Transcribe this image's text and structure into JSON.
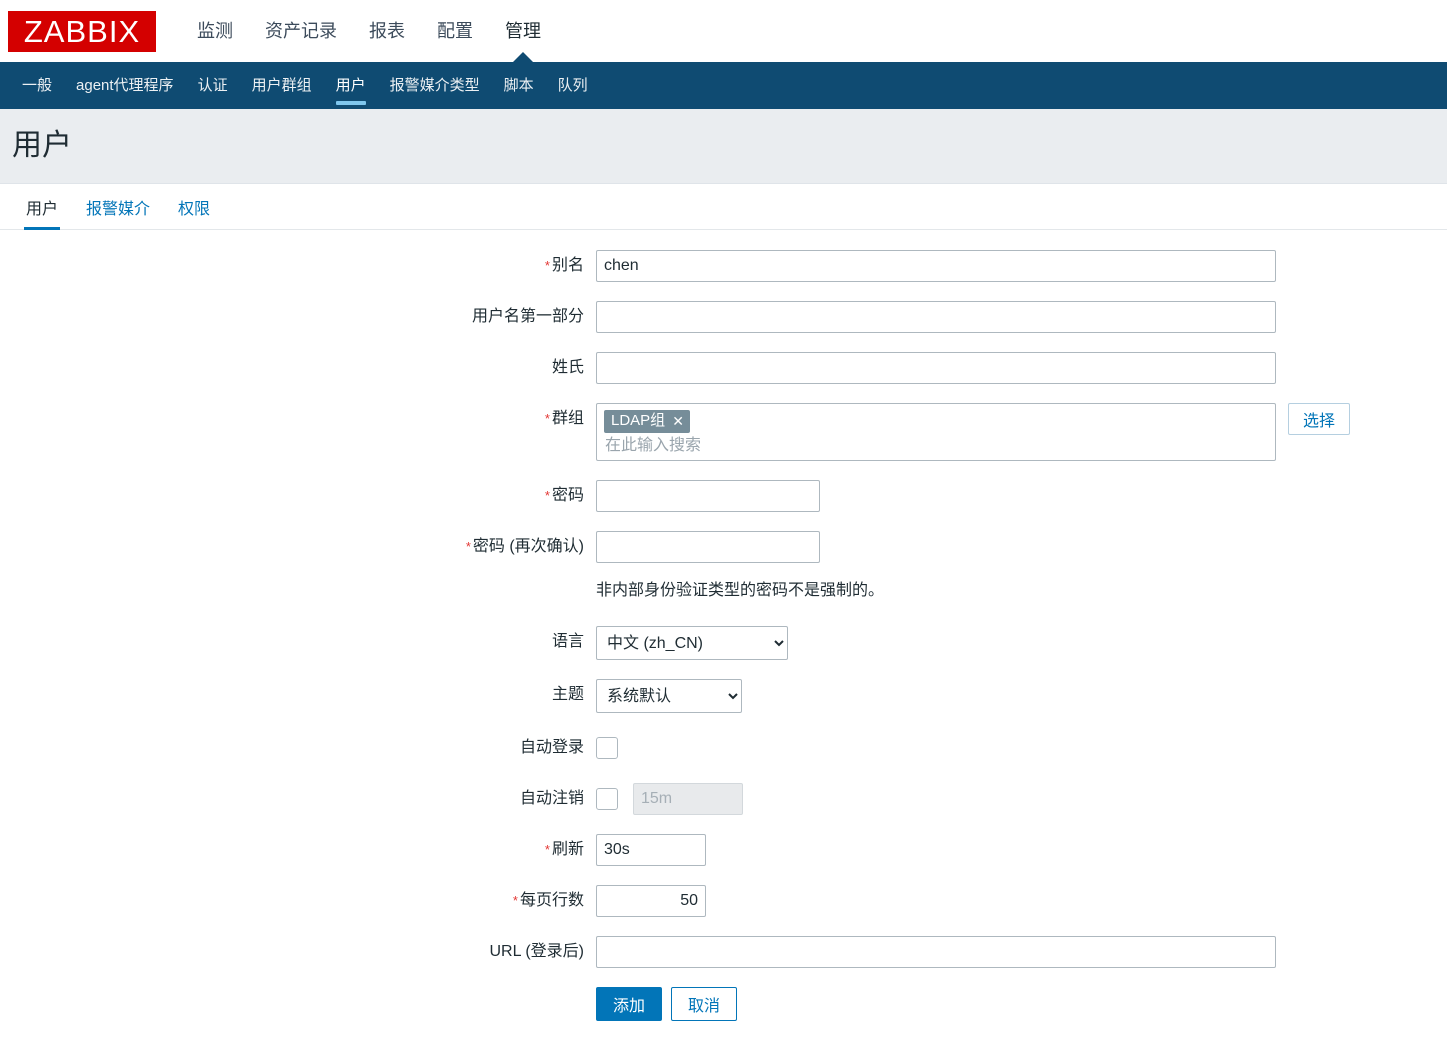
{
  "brand": {
    "logo_text": "ZABBIX",
    "logo_bg": "#d40000",
    "accent": "#0275b8",
    "subnav_bg": "#0f4b72"
  },
  "main_nav": [
    {
      "label": "监测",
      "active": false
    },
    {
      "label": "资产记录",
      "active": false
    },
    {
      "label": "报表",
      "active": false
    },
    {
      "label": "配置",
      "active": false
    },
    {
      "label": "管理",
      "active": true
    }
  ],
  "sub_nav": [
    {
      "label": "一般",
      "active": false
    },
    {
      "label": "agent代理程序",
      "active": false
    },
    {
      "label": "认证",
      "active": false
    },
    {
      "label": "用户群组",
      "active": false
    },
    {
      "label": "用户",
      "active": true
    },
    {
      "label": "报警媒介类型",
      "active": false
    },
    {
      "label": "脚本",
      "active": false
    },
    {
      "label": "队列",
      "active": false
    }
  ],
  "header": {
    "title": "用户"
  },
  "tabs": [
    {
      "label": "用户",
      "active": true
    },
    {
      "label": "报警媒介",
      "active": false
    },
    {
      "label": "权限",
      "active": false
    }
  ],
  "form": {
    "alias": {
      "label": "别名",
      "required": true,
      "value": "chen"
    },
    "name": {
      "label": "用户名第一部分",
      "required": false,
      "value": ""
    },
    "surname": {
      "label": "姓氏",
      "required": false,
      "value": ""
    },
    "groups": {
      "label": "群组",
      "required": true,
      "pills": [
        {
          "text": "LDAP组",
          "remove_icon": "✕"
        }
      ],
      "placeholder": "在此输入搜索",
      "select_button": "选择"
    },
    "password": {
      "label": "密码",
      "required": true,
      "value": ""
    },
    "password2": {
      "label": "密码 (再次确认)",
      "required": true,
      "value": ""
    },
    "password_hint": "非内部身份验证类型的密码不是强制的。",
    "language": {
      "label": "语言",
      "required": false,
      "value": "中文 (zh_CN)",
      "options": [
        "中文 (zh_CN)"
      ]
    },
    "theme": {
      "label": "主题",
      "required": false,
      "value": "系统默认",
      "options": [
        "系统默认"
      ]
    },
    "autologin": {
      "label": "自动登录",
      "required": false,
      "checked": false
    },
    "autologout": {
      "label": "自动注销",
      "required": false,
      "checked": false,
      "value": "15m",
      "disabled": true
    },
    "refresh": {
      "label": "刷新",
      "required": true,
      "value": "30s"
    },
    "rows_per_page": {
      "label": "每页行数",
      "required": true,
      "value": "50"
    },
    "url": {
      "label": "URL (登录后)",
      "required": false,
      "value": ""
    }
  },
  "actions": {
    "submit": "添加",
    "cancel": "取消"
  }
}
